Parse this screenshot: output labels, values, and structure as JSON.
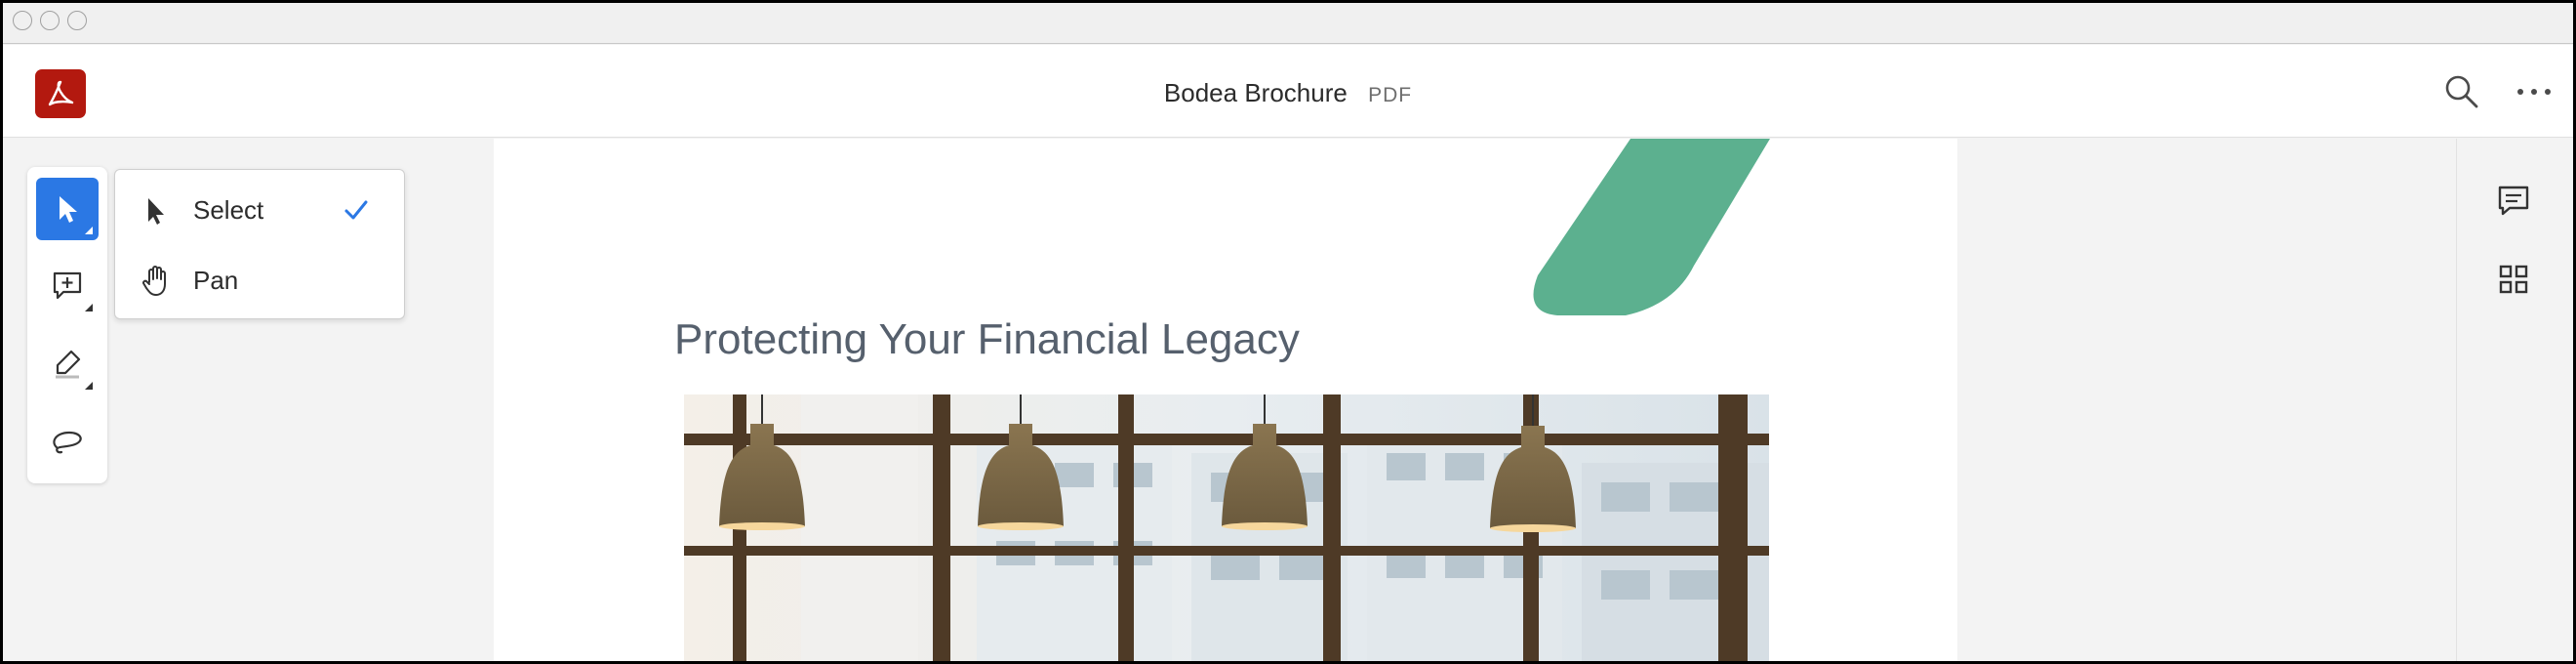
{
  "window": {
    "traffic_lights": [
      "close",
      "minimize",
      "zoom"
    ]
  },
  "header": {
    "app_icon": "acrobat-logo-icon",
    "doc_name": "Bodea Brochure",
    "doc_type": "PDF",
    "actions": [
      "search-icon",
      "more-icon"
    ]
  },
  "toolbar": {
    "tools": [
      {
        "name": "select",
        "icon": "cursor-icon",
        "active": true
      },
      {
        "name": "add-comment",
        "icon": "comment-plus-icon",
        "active": false
      },
      {
        "name": "highlight",
        "icon": "highlighter-icon",
        "active": false
      },
      {
        "name": "draw",
        "icon": "lasso-icon",
        "active": false
      }
    ]
  },
  "tool_menu": {
    "items": [
      {
        "label": "Select",
        "icon": "cursor-icon",
        "checked": true
      },
      {
        "label": "Pan",
        "icon": "hand-icon",
        "checked": false
      }
    ]
  },
  "document": {
    "heading": "Protecting Your Financial Legacy",
    "accent_color": "#5cb08f",
    "image": "office-lamps-photo"
  },
  "right_rail": {
    "buttons": [
      "comments-icon",
      "thumbnails-icon"
    ]
  },
  "colors": {
    "accent_blue": "#2b78e4",
    "logo_red": "#b3190f"
  }
}
